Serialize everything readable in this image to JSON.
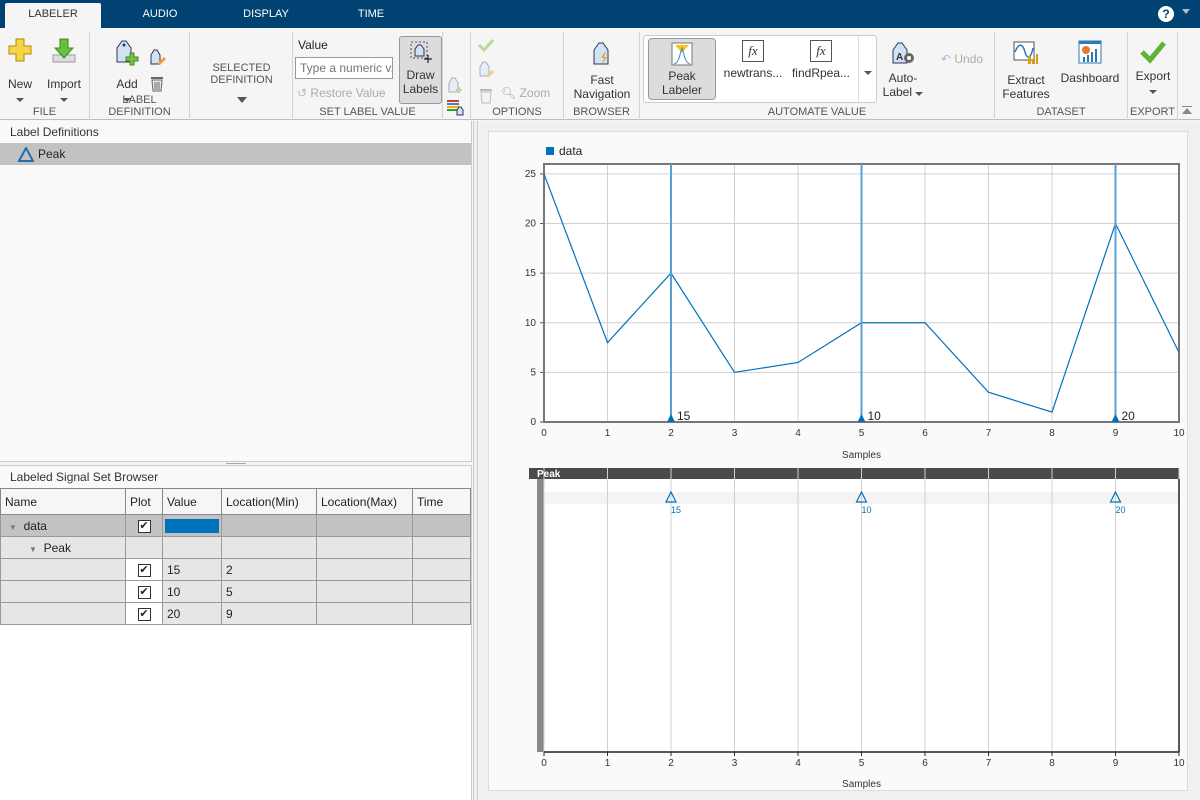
{
  "tabs": [
    {
      "label": "LABELER",
      "active": true
    },
    {
      "label": "AUDIO"
    },
    {
      "label": "DISPLAY"
    },
    {
      "label": "TIME"
    }
  ],
  "help_icon": "question-icon",
  "ribbon": {
    "file": {
      "label": "FILE",
      "new": "New",
      "import": "Import"
    },
    "label_definition": {
      "label": "LABEL DEFINITION",
      "add": "Add"
    },
    "selected_definition": {
      "line1": "SELECTED",
      "line2": "DEFINITION"
    },
    "set_label_value": {
      "label": "SET LABEL VALUE",
      "value_label": "Value",
      "placeholder": "Type a numeric v.",
      "restore": "Restore Value",
      "draw_line1": "Draw",
      "draw_line2": "Labels"
    },
    "options": {
      "label": "OPTIONS",
      "zoom": "Zoom"
    },
    "browser": {
      "label": "BROWSER",
      "fast_line1": "Fast",
      "fast_line2": "Navigation"
    },
    "automate_value": {
      "label": "AUTOMATE VALUE",
      "gallery": [
        {
          "line1": "Peak",
          "line2": "Labeler",
          "selected": true
        },
        {
          "line1": "newtrans..."
        },
        {
          "line1": "findRpea..."
        }
      ],
      "auto_line1": "Auto-",
      "auto_line2": "Label",
      "undo": "Undo"
    },
    "dataset": {
      "label": "DATASET",
      "extract_line1": "Extract",
      "extract_line2": "Features",
      "dashboard": "Dashboard"
    },
    "export": {
      "label": "EXPORT",
      "export": "Export"
    }
  },
  "label_definitions": {
    "title": "Label Definitions",
    "items": [
      {
        "name": "Peak"
      }
    ]
  },
  "browser": {
    "title": "Labeled Signal Set Browser",
    "columns": [
      "Name",
      "Plot",
      "Value",
      "Location(Min)",
      "Location(Max)",
      "Time"
    ],
    "rows": [
      {
        "name": "data",
        "plot": true,
        "value_color": "#0072bd",
        "level": 0,
        "expanded": true
      },
      {
        "name": "Peak",
        "level": 1,
        "expanded": true
      },
      {
        "plot": true,
        "value": "15",
        "loc_min": "2"
      },
      {
        "plot": true,
        "value": "10",
        "loc_min": "5"
      },
      {
        "plot": true,
        "value": "20",
        "loc_min": "9"
      }
    ]
  },
  "colors": {
    "accent": "#0072bd",
    "tabbar": "#004272"
  },
  "chart_data": [
    {
      "type": "line",
      "legend": [
        "data"
      ],
      "legend_placement": "top-left",
      "x": [
        0,
        1,
        2,
        3,
        4,
        5,
        6,
        7,
        8,
        9,
        10
      ],
      "series": [
        {
          "name": "data",
          "values": [
            25,
            8,
            15,
            5,
            6,
            10,
            10,
            3,
            1,
            20,
            7
          ]
        }
      ],
      "xlabel": "Samples",
      "ylabel": "",
      "xlim": [
        0,
        10
      ],
      "ylim": [
        0,
        26
      ],
      "xticks": [
        0,
        1,
        2,
        3,
        4,
        5,
        6,
        7,
        8,
        9,
        10
      ],
      "yticks": [
        0,
        5,
        10,
        15,
        20,
        25
      ],
      "grid": true,
      "annotations": [
        {
          "x": 2,
          "label": "15"
        },
        {
          "x": 5,
          "label": "10"
        },
        {
          "x": 9,
          "label": "20"
        }
      ]
    },
    {
      "type": "scatter",
      "title": "Peak",
      "x": [
        2,
        5,
        9
      ],
      "labels": [
        "15",
        "10",
        "20"
      ],
      "xlabel": "Samples",
      "xlim": [
        0,
        10
      ],
      "xticks": [
        0,
        1,
        2,
        3,
        4,
        5,
        6,
        7,
        8,
        9,
        10
      ],
      "grid": true
    }
  ]
}
